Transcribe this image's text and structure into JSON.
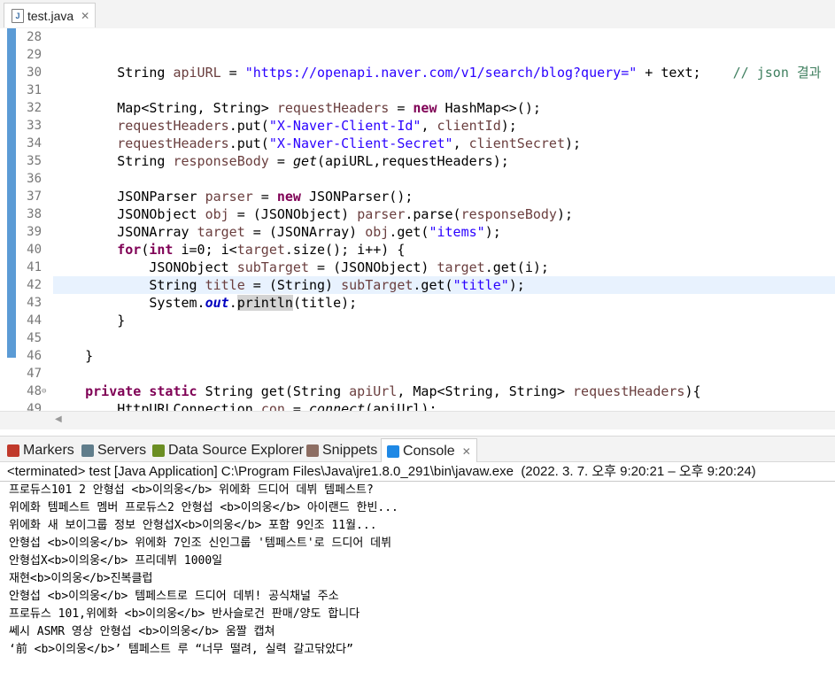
{
  "editor_tab": {
    "title": "test.java",
    "icon": "java-file-icon",
    "close": "✕"
  },
  "editor": {
    "highlighted_line": 42,
    "lines": [
      {
        "n": "28",
        "parts": []
      },
      {
        "n": "29",
        "parts": []
      },
      {
        "n": "30",
        "parts": [
          [
            "",
            "        String "
          ],
          [
            "fld",
            "apiURL"
          ],
          [
            "",
            " = "
          ],
          [
            "str",
            "\"https://openapi.naver.com/v1/search/blog?query=\""
          ],
          [
            "",
            " + text;    "
          ],
          [
            "cm",
            "// json 결과"
          ]
        ]
      },
      {
        "n": "31",
        "parts": []
      },
      {
        "n": "32",
        "parts": [
          [
            "",
            "        Map<String, String> "
          ],
          [
            "fld",
            "requestHeaders"
          ],
          [
            "",
            " = "
          ],
          [
            "kw",
            "new"
          ],
          [
            "",
            " HashMap<>();"
          ]
        ]
      },
      {
        "n": "33",
        "parts": [
          [
            "fld",
            "        requestHeaders"
          ],
          [
            "",
            ".put("
          ],
          [
            "str",
            "\"X-Naver-Client-Id\""
          ],
          [
            "",
            ", "
          ],
          [
            "fld",
            "clientId"
          ],
          [
            "",
            ");"
          ]
        ]
      },
      {
        "n": "34",
        "parts": [
          [
            "fld",
            "        requestHeaders"
          ],
          [
            "",
            ".put("
          ],
          [
            "str",
            "\"X-Naver-Client-Secret\""
          ],
          [
            "",
            ", "
          ],
          [
            "fld",
            "clientSecret"
          ],
          [
            "",
            ");"
          ]
        ]
      },
      {
        "n": "35",
        "parts": [
          [
            "",
            "        String "
          ],
          [
            "fld",
            "responseBody"
          ],
          [
            "",
            " = "
          ],
          [
            "it",
            "get"
          ],
          [
            "",
            "(apiURL,requestHeaders);"
          ]
        ]
      },
      {
        "n": "36",
        "parts": []
      },
      {
        "n": "37",
        "parts": [
          [
            "",
            "        JSONParser "
          ],
          [
            "fld",
            "parser"
          ],
          [
            "",
            " = "
          ],
          [
            "kw",
            "new"
          ],
          [
            "",
            " JSONParser();"
          ]
        ]
      },
      {
        "n": "38",
        "parts": [
          [
            "",
            "        JSONObject "
          ],
          [
            "fld",
            "obj"
          ],
          [
            "",
            " = (JSONObject) "
          ],
          [
            "fld",
            "parser"
          ],
          [
            "",
            ".parse("
          ],
          [
            "fld",
            "responseBody"
          ],
          [
            "",
            ");"
          ]
        ]
      },
      {
        "n": "39",
        "parts": [
          [
            "",
            "        JSONArray "
          ],
          [
            "fld",
            "target"
          ],
          [
            "",
            " = (JSONArray) "
          ],
          [
            "fld",
            "obj"
          ],
          [
            "",
            ".get("
          ],
          [
            "str",
            "\"items\""
          ],
          [
            "",
            ");"
          ]
        ]
      },
      {
        "n": "40",
        "parts": [
          [
            "kw",
            "        for"
          ],
          [
            "",
            "("
          ],
          [
            "kw",
            "int"
          ],
          [
            "",
            " i=0; i<"
          ],
          [
            "fld",
            "target"
          ],
          [
            "",
            ".size(); i++) {"
          ]
        ]
      },
      {
        "n": "41",
        "parts": [
          [
            "",
            "            JSONObject "
          ],
          [
            "fld",
            "subTarget"
          ],
          [
            "",
            " = (JSONObject) "
          ],
          [
            "fld",
            "target"
          ],
          [
            "",
            ".get(i);"
          ]
        ]
      },
      {
        "n": "42",
        "parts": [
          [
            "",
            "            String "
          ],
          [
            "fld",
            "title"
          ],
          [
            "",
            " = (String) "
          ],
          [
            "fld",
            "subTarget"
          ],
          [
            "",
            ".get("
          ],
          [
            "str",
            "\"title\""
          ],
          [
            "",
            ");"
          ]
        ]
      },
      {
        "n": "43",
        "parts": [
          [
            "",
            "            System."
          ],
          [
            "sf",
            "out"
          ],
          [
            "",
            "."
          ],
          [
            "sel",
            "println"
          ],
          [
            "",
            "(title);"
          ]
        ]
      },
      {
        "n": "44",
        "parts": [
          [
            "",
            "        }"
          ]
        ]
      },
      {
        "n": "45",
        "parts": []
      },
      {
        "n": "46",
        "parts": [
          [
            "",
            "    }"
          ]
        ]
      },
      {
        "n": "47",
        "parts": []
      },
      {
        "n": "48",
        "fold": "⊖",
        "parts": [
          [
            "kw",
            "    private static"
          ],
          [
            "",
            " String get(String "
          ],
          [
            "fld",
            "apiUrl"
          ],
          [
            "",
            ", Map<String, String> "
          ],
          [
            "fld",
            "requestHeaders"
          ],
          [
            "",
            "){"
          ]
        ]
      },
      {
        "n": "49",
        "parts": [
          [
            "",
            "        HttpURLConnection "
          ],
          [
            "fld",
            "con"
          ],
          [
            "",
            " = "
          ],
          [
            "it",
            "connect"
          ],
          [
            "",
            "(apiUrl);"
          ]
        ]
      }
    ]
  },
  "views_tabs": [
    {
      "label": "Markers",
      "icon": "markers-icon",
      "color": "#c0392b"
    },
    {
      "label": "Servers",
      "icon": "servers-icon",
      "color": "#607d8b"
    },
    {
      "label": "Data Source Explorer",
      "icon": "data-source-icon",
      "color": "#6b8e23"
    },
    {
      "label": "Snippets",
      "icon": "snippets-icon",
      "color": "#8d6e63"
    },
    {
      "label": "Console",
      "icon": "console-icon",
      "color": "#1e88e5",
      "active": true,
      "close": "✕"
    }
  ],
  "console": {
    "status": "<terminated> test [Java Application] C:\\Program Files\\Java\\jre1.8.0_291\\bin\\javaw.exe  (2022. 3. 7. 오후 9:20:21 – 오후 9:20:24)",
    "lines": [
      "프로듀스101 2 안형섭 <b>이의웅</b> 위에화 드디어 데뷔 템페스트?",
      "위에화 템페스트 멤버 프로듀스2 안형섭 <b>이의웅</b> 아이랜드 한빈...",
      "위에화 새 보이그룹 정보 안형섭X<b>이의웅</b> 포함 9인조 11월...",
      "안형섭 <b>이의웅</b> 위에화 7인조 신인그룹 '템페스트'로 드디어 데뷔",
      "안형섭X<b>이의웅</b> 프리데뷔 1000일",
      "재현<b>이의웅</b>진복클럽",
      "안형섭 <b>이의웅</b> 템페스트로 드디어 데뷔! 공식채널 주소",
      "프로듀스 101,위에화 <b>이의웅</b> 반사슬로건 판매/양도 합니다",
      "쎄시 ASMR 영상 안형섭 <b>이의웅</b> 움짤 캡쳐",
      "‘前 <b>이의웅</b>’ 템페스트 루 “너무 떨려, 실력 갈고닦았다”"
    ]
  }
}
